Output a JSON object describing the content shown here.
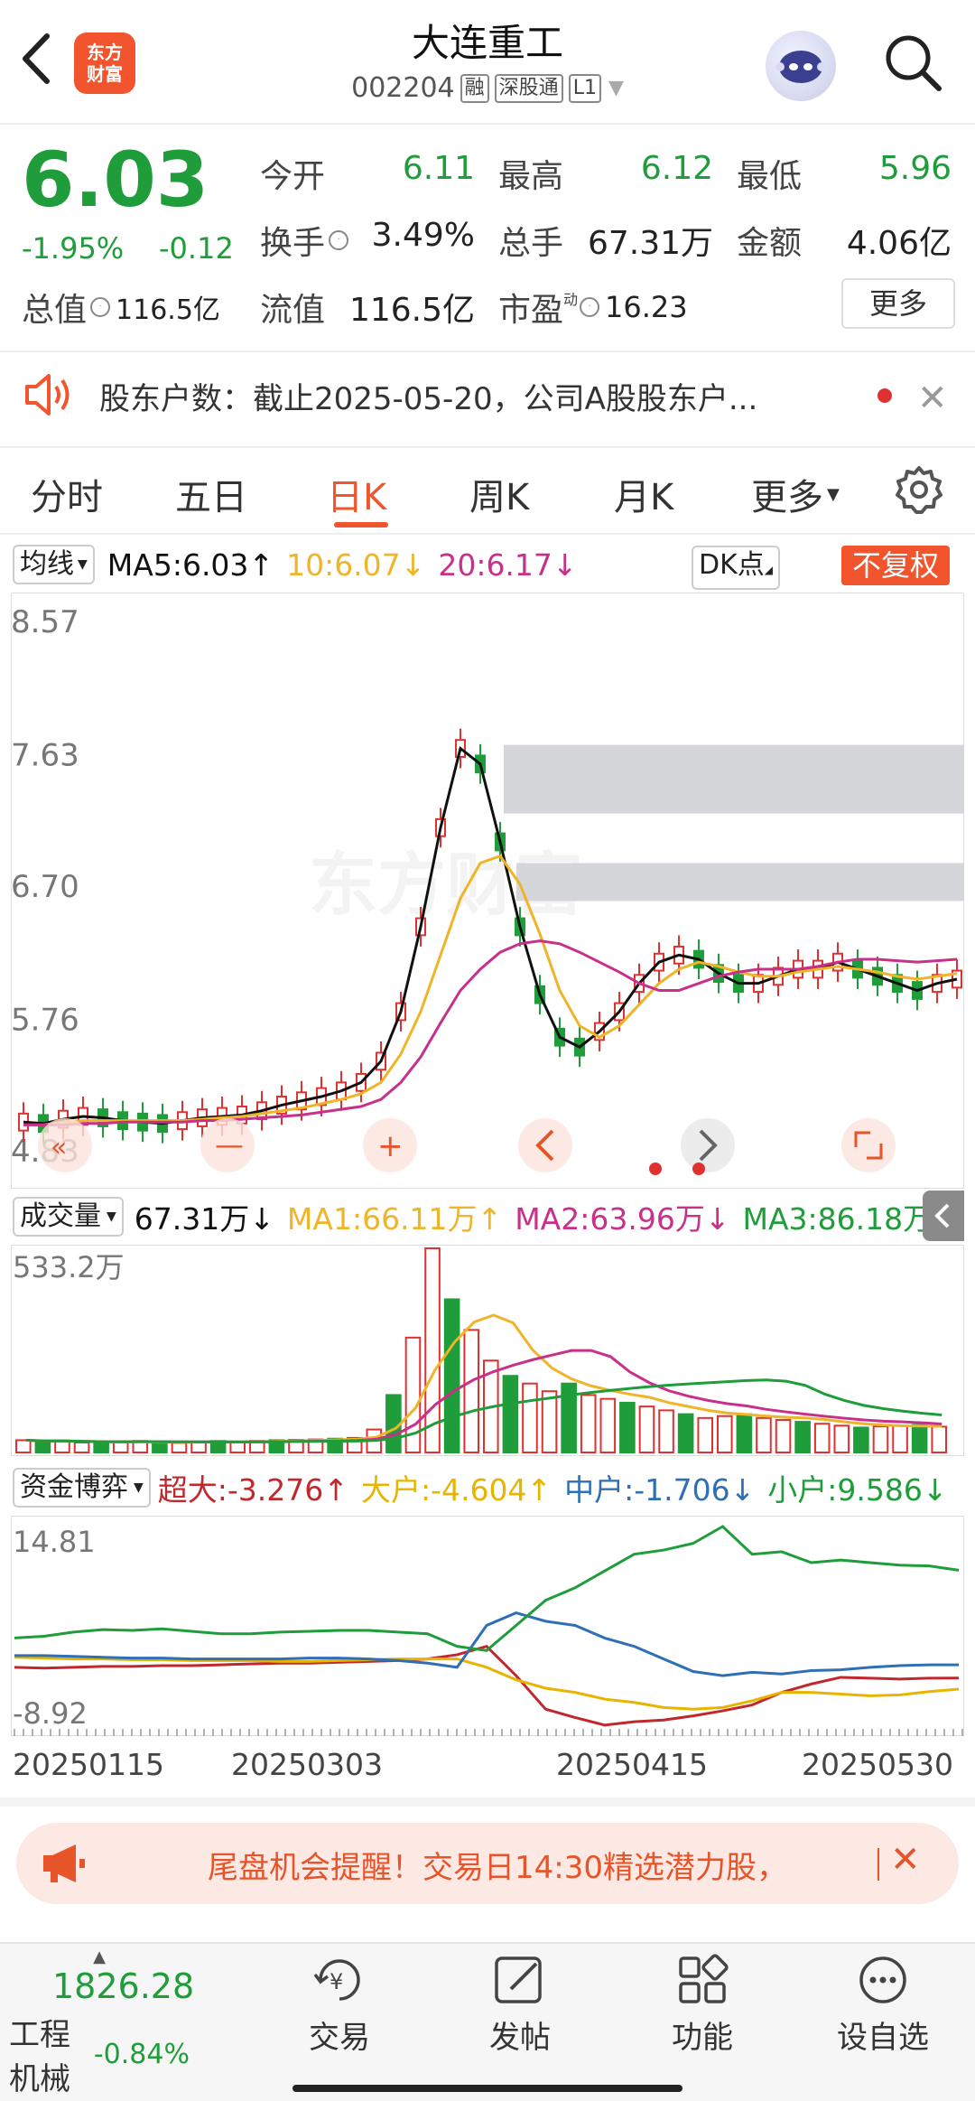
{
  "header": {
    "title": "大连重工",
    "code": "002204",
    "tags": [
      "融",
      "深股通",
      "L1"
    ],
    "logo": [
      "东方",
      "财富"
    ]
  },
  "quote": {
    "price": "6.03",
    "pct": "-1.95%",
    "change": "-0.12",
    "stats": [
      {
        "label": "今开",
        "value": "6.11",
        "color": "green"
      },
      {
        "label": "最高",
        "value": "6.12",
        "color": "green"
      },
      {
        "label": "最低",
        "value": "5.96",
        "color": "green"
      },
      {
        "label": "换手",
        "value": "3.49%",
        "color": "dark"
      },
      {
        "label": "总手",
        "value": "67.31万",
        "color": "dark"
      },
      {
        "label": "金额",
        "value": "4.06亿",
        "color": "dark"
      },
      {
        "label": "总值",
        "value": "116.5亿",
        "color": "dark"
      },
      {
        "label": "流值",
        "value": "116.5亿",
        "color": "dark"
      },
      {
        "label": "市盈",
        "value": "16.23",
        "color": "dark"
      }
    ],
    "pe_sup": "动",
    "more": "更多"
  },
  "notice": {
    "text": "股东户数：截止2025-05-20，公司A股股东户..."
  },
  "tabs": [
    "分时",
    "五日",
    "日K",
    "周K",
    "月K",
    "更多"
  ],
  "active_tab": "日K",
  "ma": {
    "selector": "均线",
    "ma5": "MA5:6.03↑",
    "ma10": "10:6.07↓",
    "ma20": "20:6.17↓",
    "dk": "DK点",
    "fq": "不复权"
  },
  "kchart": {
    "y_labels": [
      "8.57",
      "7.63",
      "6.70",
      "5.76",
      "4.83"
    ],
    "watermark": "东方财富"
  },
  "volume": {
    "selector": "成交量",
    "vol": "67.31万↓",
    "ma1": "MA1:66.11万↑",
    "ma2": "MA2:63.96万↓",
    "ma3": "MA3:86.18万↓",
    "top_label": "533.2万"
  },
  "fund": {
    "selector": "资金博弈",
    "super": "超大:-3.276↑",
    "big": "大户:-4.604↑",
    "mid": "中户:-1.706↓",
    "small": "小户:9.586↓",
    "top_label": "14.81",
    "bottom_label": "-8.92"
  },
  "dates": [
    "20250115",
    "20250303",
    "20250415",
    "20250530"
  ],
  "banner": {
    "text": "尾盘机会提醒！交易日14:30精选潜力股，"
  },
  "bottom_nav": {
    "index_value": "1826.28",
    "index_name": "工程机械",
    "index_change": "-0.84%",
    "items": [
      "交易",
      "发帖",
      "功能",
      "设自选"
    ]
  },
  "colors": {
    "up": "#e03131",
    "down": "#1f9d3a",
    "accent": "#f2542d",
    "ma5": "#111111",
    "ma10": "#f0b428",
    "ma20": "#c8308a"
  },
  "chart_data": [
    {
      "type": "candlestick",
      "title": "",
      "ylim": [
        4.83,
        8.57
      ],
      "series": [
        {
          "name": "MA5",
          "values": [
            5.02,
            5.01,
            5.04,
            5.06,
            5.05,
            5.03,
            5.02,
            5.01,
            5.03,
            5.05,
            5.06,
            5.07,
            5.1,
            5.14,
            5.17,
            5.2,
            5.24,
            5.3,
            5.45,
            5.8,
            6.4,
            7.1,
            7.66,
            7.55,
            7.0,
            6.4,
            5.92,
            5.62,
            5.55,
            5.66,
            5.8,
            6.0,
            6.15,
            6.2,
            6.17,
            6.07,
            6.0,
            6.0,
            6.05,
            6.1,
            6.1,
            6.15,
            6.1,
            6.05,
            6.0,
            5.95,
            6.0,
            6.03
          ]
        },
        {
          "name": "10",
          "values": [
            5.0,
            5.0,
            5.02,
            5.03,
            5.03,
            5.03,
            5.03,
            5.03,
            5.03,
            5.04,
            5.05,
            5.06,
            5.08,
            5.1,
            5.12,
            5.15,
            5.18,
            5.22,
            5.3,
            5.5,
            5.8,
            6.2,
            6.6,
            6.85,
            6.9,
            6.7,
            6.35,
            5.95,
            5.7,
            5.62,
            5.7,
            5.85,
            6.0,
            6.1,
            6.15,
            6.12,
            6.08,
            6.05,
            6.05,
            6.08,
            6.1,
            6.12,
            6.1,
            6.08,
            6.05,
            6.03,
            6.05,
            6.07
          ]
        },
        {
          "name": "20",
          "values": [
            5.0,
            5.0,
            5.0,
            5.01,
            5.01,
            5.02,
            5.02,
            5.02,
            5.02,
            5.03,
            5.03,
            5.04,
            5.05,
            5.06,
            5.07,
            5.09,
            5.11,
            5.13,
            5.18,
            5.3,
            5.48,
            5.72,
            5.95,
            6.1,
            6.22,
            6.28,
            6.3,
            6.28,
            6.22,
            6.15,
            6.08,
            6.0,
            5.95,
            5.95,
            6.0,
            6.05,
            6.08,
            6.1,
            6.1,
            6.1,
            6.12,
            6.15,
            6.17,
            6.17,
            6.16,
            6.15,
            6.16,
            6.17
          ]
        }
      ]
    },
    {
      "type": "bar",
      "title": "成交量",
      "ylim": [
        0,
        5332000
      ],
      "series": [
        {
          "name": "成交量",
          "values": [
            320000,
            280000,
            300000,
            260000,
            240000,
            280000,
            300000,
            260000,
            250000,
            270000,
            300000,
            280000,
            300000,
            320000,
            330000,
            340000,
            360000,
            380000,
            600000,
            1500000,
            3000000,
            5332000,
            4000000,
            3200000,
            2400000,
            2000000,
            1800000,
            1600000,
            1800000,
            1500000,
            1400000,
            1300000,
            1200000,
            1100000,
            1000000,
            900000,
            950000,
            1000000,
            900000,
            850000,
            800000,
            750000,
            700000,
            650000,
            680000,
            700000,
            720000,
            673100
          ]
        }
      ]
    },
    {
      "type": "line",
      "title": "资金博弈",
      "ylim": [
        -8.92,
        14.81
      ],
      "series": [
        {
          "name": "超大",
          "values": [
            -2.0,
            -2.1,
            -2.0,
            -1.9,
            -1.9,
            -1.8,
            -1.8,
            -1.7,
            -1.6,
            -1.5,
            -1.5,
            -1.4,
            -1.3,
            -1.2,
            -1.0,
            -0.5,
            0.5,
            -3.0,
            -7.0,
            -8.0,
            -8.9,
            -8.5,
            -8.3,
            -7.8,
            -7.2,
            -6.5,
            -5.0,
            -4.0,
            -3.2,
            -3.3,
            -3.4,
            -3.3,
            -3.28
          ]
        },
        {
          "name": "大户",
          "values": [
            -0.8,
            -0.9,
            -1.0,
            -1.0,
            -1.1,
            -1.1,
            -1.2,
            -1.2,
            -1.2,
            -1.3,
            -1.3,
            -1.2,
            -1.1,
            -1.0,
            -1.0,
            -1.0,
            -2.0,
            -3.5,
            -4.5,
            -5.0,
            -5.8,
            -6.2,
            -6.8,
            -7.0,
            -6.8,
            -6.0,
            -5.0,
            -5.0,
            -5.2,
            -5.4,
            -5.3,
            -4.9,
            -4.6
          ]
        },
        {
          "name": "中户",
          "values": [
            -0.6,
            -0.6,
            -0.7,
            -0.8,
            -0.9,
            -0.9,
            -1.0,
            -1.0,
            -1.0,
            -1.0,
            -0.9,
            -0.9,
            -1.0,
            -1.2,
            -1.5,
            -2.0,
            3.0,
            4.5,
            3.5,
            3.0,
            1.5,
            0.5,
            -1.0,
            -2.5,
            -3.0,
            -2.6,
            -2.8,
            -2.4,
            -2.3,
            -2.0,
            -1.8,
            -1.7,
            -1.71
          ]
        },
        {
          "name": "小户",
          "values": [
            1.5,
            1.7,
            2.2,
            2.5,
            2.4,
            2.6,
            2.3,
            2.0,
            2.0,
            2.2,
            2.3,
            2.4,
            2.4,
            2.2,
            2.0,
            0.5,
            0.0,
            3.0,
            6.0,
            7.5,
            9.5,
            11.5,
            12.0,
            12.8,
            14.81,
            11.5,
            11.8,
            10.5,
            10.8,
            10.5,
            10.2,
            10.1,
            9.59
          ]
        }
      ]
    }
  ]
}
